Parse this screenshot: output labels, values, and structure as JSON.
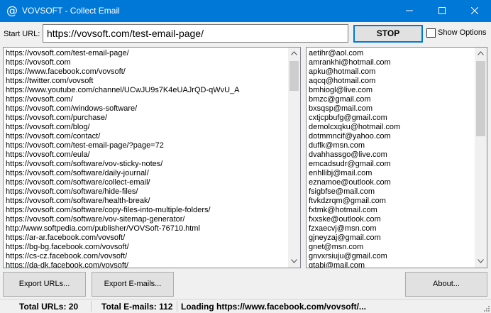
{
  "window": {
    "title": "VOVSOFT - Collect Email",
    "icon": "at-sign-icon",
    "icon_glyph": "@",
    "accent_color": "#0078d7"
  },
  "toolbar": {
    "url_label": "Start URL:",
    "url_value": "https://vovsoft.com/test-email-page/",
    "stop_label": "STOP",
    "show_options_label": "Show Options"
  },
  "urls": [
    "https://vovsoft.com/test-email-page/",
    "https://vovsoft.com",
    "https://www.facebook.com/vovsoft/",
    "https://twitter.com/vovsoft",
    "https://www.youtube.com/channel/UCwJU9s7K4eUAJrQD-qWvU_A",
    "https://vovsoft.com/",
    "https://vovsoft.com/windows-software/",
    "https://vovsoft.com/purchase/",
    "https://vovsoft.com/blog/",
    "https://vovsoft.com/contact/",
    "https://vovsoft.com/test-email-page/?page=72",
    "https://vovsoft.com/eula/",
    "https://vovsoft.com/software/vov-sticky-notes/",
    "https://vovsoft.com/software/daily-journal/",
    "https://vovsoft.com/software/collect-email/",
    "https://vovsoft.com/software/hide-files/",
    "https://vovsoft.com/software/health-break/",
    "https://vovsoft.com/software/copy-files-into-multiple-folders/",
    "https://vovsoft.com/software/vov-sitemap-generator/",
    "http://www.softpedia.com/publisher/VOVSoft-76710.html",
    "https://ar-ar.facebook.com/vovsoft/",
    "https://bg-bg.facebook.com/vovsoft/",
    "https://cs-cz.facebook.com/vovsoft/",
    "https://da-dk.facebook.com/vovsoft/"
  ],
  "emails": [
    "aetihr@aol.com",
    "amrankhi@hotmail.com",
    "apku@hotmail.com",
    "aqcq@hotmail.com",
    "bmhiogl@live.com",
    "bmzc@gmail.com",
    "bxsqsp@mail.com",
    "cxtjcpbufg@gmail.com",
    "demolcxqku@hotmail.com",
    "dotmmncif@yahoo.com",
    "duflk@msn.com",
    "dvahhassgo@live.com",
    "emcadsudr@gmail.com",
    "enhllibj@mail.com",
    "eznamoe@outlook.com",
    "fsigbfse@mail.com",
    "ftvkdzrqm@gmail.com",
    "fxtmk@hotmail.com",
    "fxxske@outlook.com",
    "fzxaecvj@msn.com",
    "gjneyzaj@gmail.com",
    "gnet@msn.com",
    "gnvxrsiuju@gmail.com",
    "gtabi@mail.com"
  ],
  "buttons": {
    "export_urls": "Export URLs...",
    "export_emails": "Export E-mails...",
    "about": "About..."
  },
  "status": {
    "total_urls": "Total URLs: 20",
    "total_emails": "Total E-mails: 112",
    "loading": "Loading https://www.facebook.com/vovsoft/..."
  }
}
